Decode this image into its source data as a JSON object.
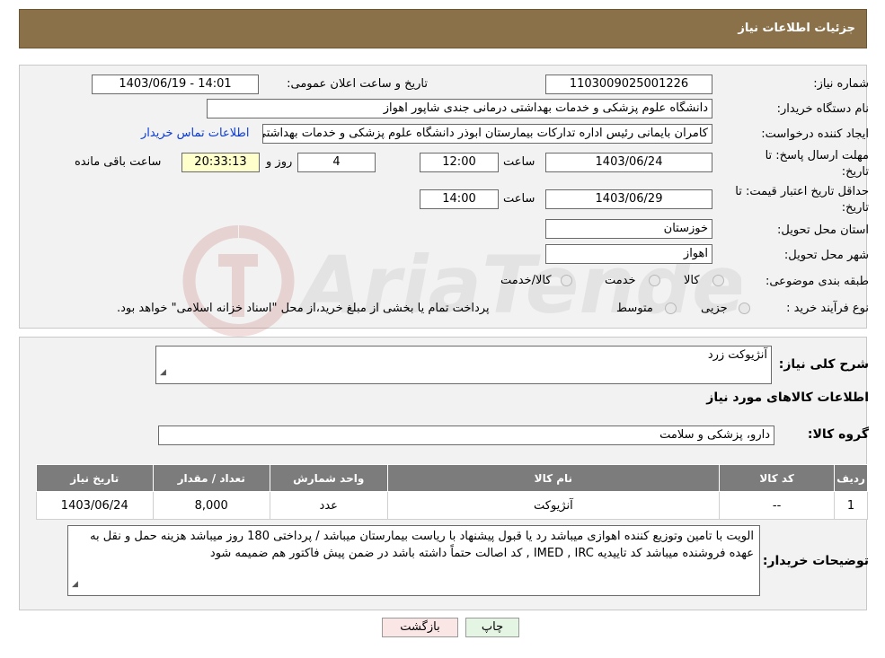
{
  "header": {
    "title": "جزئیات اطلاعات نیاز"
  },
  "watermark": {
    "text": "AriaTender.neT"
  },
  "fields": {
    "need_number_label": "شماره نیاز:",
    "need_number": "1103009025001226",
    "announce_label": "تاریخ و ساعت اعلان عمومی:",
    "announce_value": "1403/06/19 - 14:01",
    "buyer_org_label": "نام دستگاه خریدار:",
    "buyer_org": "دانشگاه علوم پزشکی و خدمات بهداشتی درمانی جندی شاپور اهواز",
    "requester_label": "ایجاد کننده درخواست:",
    "requester": "کامران بایمانی رئیس اداره تدارکات بیمارستان ابوذر  دانشگاه علوم پزشکی و خدمات بهداشتی درمانی",
    "contact_link": "اطلاعات تماس خریدار",
    "deadline_label_1": "مهلت ارسال پاسخ: تا",
    "deadline_label_2": "تاریخ:",
    "deadline_date": "1403/06/24",
    "time_label": "ساعت",
    "deadline_time": "12:00",
    "days_value": "4",
    "days_label": "روز و",
    "remaining_time": "20:33:13",
    "remaining_label": "ساعت باقی مانده",
    "validity_label_1": "حداقل تاریخ اعتبار قیمت: تا",
    "validity_label_2": "تاریخ:",
    "validity_date": "1403/06/29",
    "validity_time": "14:00",
    "province_label": "استان محل تحویل:",
    "province": "خوزستان",
    "city_label": "شهر محل تحویل:",
    "city": "اهواز",
    "category_label": "طبقه بندی موضوعی:",
    "category_options": [
      "کالا",
      "خدمت",
      "کالا/خدمت"
    ],
    "purchase_type_label": "نوع فرآیند خرید :",
    "purchase_options": [
      "جزیی",
      "متوسط"
    ],
    "purchase_note": "پرداخت تمام یا بخشی از مبلغ خرید،از محل \"اسناد خزانه اسلامی\" خواهد بود."
  },
  "details": {
    "summary_label": "شرح کلی نیاز:",
    "summary": "آنژیوکت زرد",
    "goods_info_title": "اطلاعات کالاهای مورد نیاز",
    "goods_group_label": "گروه کالا:",
    "goods_group": "دارو، پزشکی و سلامت",
    "table_headers": [
      "ردیف",
      "کد کالا",
      "نام کالا",
      "واحد شمارش",
      "تعداد / مقدار",
      "تاریخ نیاز"
    ],
    "table_rows": [
      [
        "1",
        "--",
        "آنژیوکت",
        "عدد",
        "8,000",
        "1403/06/24"
      ]
    ],
    "buyer_notes_label": "توضیحات خریدار:",
    "buyer_notes": "الویت با تامین وتوزیع کننده اهوازی  میباشد رد یا قبول پیشنهاد با ریاست بیمارستان میباشد / پرداختی 180 روز   میباشد هزینه حمل و نقل به عهده فروشنده میباشد   کد تاییدیه IMED , IRC , کد اصالت حتماً داشته باشد در ضمن پیش فاکتور هم ضمیمه شود"
  },
  "buttons": {
    "print": "چاپ",
    "back": "بازگشت"
  }
}
